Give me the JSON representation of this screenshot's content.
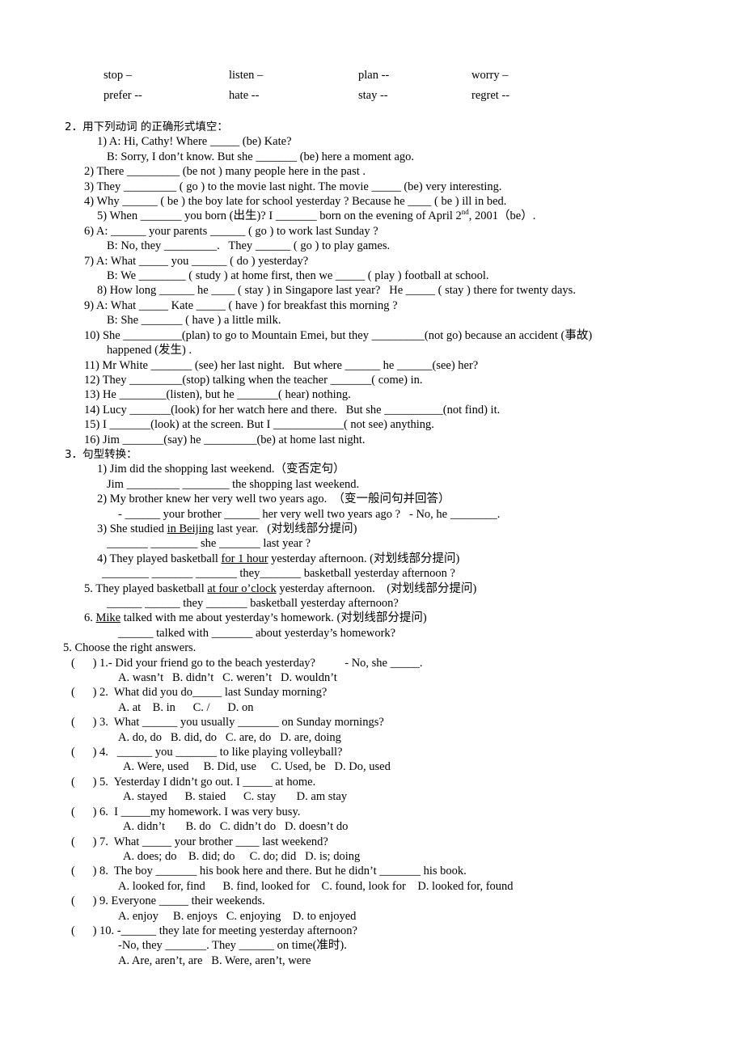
{
  "document": {
    "type": "english-grammar-worksheet",
    "verb_list": {
      "rows": [
        [
          "stop –",
          "listen –",
          "plan --",
          "worry –"
        ],
        [
          "prefer --",
          "hate --",
          "stay --",
          "regret --"
        ]
      ]
    },
    "section2": {
      "heading": "2．用下列动词 的正确形式填空：",
      "items": [
        {
          "id": "2-1a",
          "text": "1) A: Hi, Cathy! Where _____ (be) Kate?"
        },
        {
          "id": "2-1b",
          "text": "B: Sorry, I don’t know. But she _______ (be) here a moment ago."
        },
        {
          "id": "2-2",
          "text": "2) There _________ (be not ) many people here in the past ."
        },
        {
          "id": "2-3",
          "text": "3) They _________ ( go ) to the movie last night. The movie _____ (be) very interesting."
        },
        {
          "id": "2-4",
          "text": "4) Why ______ ( be ) the boy late for school yesterday ? Because he ____ ( be ) ill in bed."
        },
        {
          "id": "2-5pre",
          "text": "5) When _______ you born (出生)? I _______ born on the evening of April 2"
        },
        {
          "id": "2-5sup",
          "text": "nd"
        },
        {
          "id": "2-5post",
          "text": ", 2001（be）."
        },
        {
          "id": "2-6a",
          "text": "6) A: ______ your parents ______ ( go ) to work last Sunday ?"
        },
        {
          "id": "2-6b",
          "text": "B: No, they _________.   They ______ ( go ) to play games."
        },
        {
          "id": "2-7a",
          "text": "7) A: What _____ you ______ ( do ) yesterday?"
        },
        {
          "id": "2-7b",
          "text": "B: We ________ ( study ) at home first, then we _____ ( play ) football at school."
        },
        {
          "id": "2-8",
          "text": "8) How long ______ he ____ ( stay ) in Singapore last year?   He _____ ( stay ) there for twenty days."
        },
        {
          "id": "2-9a",
          "text": "9) A: What _____ Kate _____ ( have ) for breakfast this morning ?"
        },
        {
          "id": "2-9b",
          "text": "B: She _______ ( have ) a little milk."
        },
        {
          "id": "2-10a",
          "text": "10) She __________(plan) to go to Mountain Emei, but they _________(not go) because an accident (事故)"
        },
        {
          "id": "2-10b",
          "text": "happened (发生) ."
        },
        {
          "id": "2-11",
          "text": "11) Mr White _______ (see) her last night.   But where ______ he ______(see) her?"
        },
        {
          "id": "2-12",
          "text": "12) They _________(stop) talking when the teacher _______( come) in."
        },
        {
          "id": "2-13",
          "text": "13) He ________(listen), but he _______( hear) nothing."
        },
        {
          "id": "2-14",
          "text": "14) Lucy _______(look) for her watch here and there.   But she __________(not find) it."
        },
        {
          "id": "2-15",
          "text": "15) I _______(look) at the screen. But I ____________( not see) anything."
        },
        {
          "id": "2-16",
          "text": "16) Jim _______(say) he _________(be) at home last night."
        }
      ]
    },
    "section3": {
      "heading": "3．句型转换：",
      "items": [
        {
          "id": "3-1q",
          "text": "1) Jim did the shopping last weekend.（变否定句）"
        },
        {
          "id": "3-1a",
          "text": "Jim _________ ________ the shopping last weekend."
        },
        {
          "id": "3-2q",
          "text": "2) My brother knew her very well two years ago.  （变一般问句并回答）"
        },
        {
          "id": "3-2a",
          "text": "- ______ your brother ______ her very well two years ago ?   - No, he ________."
        },
        {
          "id": "3-3q",
          "text": "3) She studied in Beijing last year.   (对划线部分提问)"
        },
        {
          "id": "3-3q_underline",
          "text": "in Beijing"
        },
        {
          "id": "3-3a",
          "text": "_______ ________ she _______ last year ?"
        },
        {
          "id": "3-4q",
          "text": "4) They played basketball for 1 hour yesterday afternoon. (对划线部分提问)"
        },
        {
          "id": "3-4q_underline",
          "text": "for 1 hour"
        },
        {
          "id": "3-4a",
          "text": "________ _______ _______ they_______ basketball yesterday afternoon ?"
        },
        {
          "id": "3-5q",
          "text": "5. They played basketball at four o’clock yesterday afternoon.    (对划线部分提问)"
        },
        {
          "id": "3-5q_underline",
          "text": "at four o’clock"
        },
        {
          "id": "3-5a",
          "text": "______ ______ they _______ basketball yesterday afternoon?"
        },
        {
          "id": "3-6q",
          "text": "6. Mike talked with me about yesterday’s homework. (对划线部分提问)"
        },
        {
          "id": "3-6q_underline",
          "text": "Mike"
        },
        {
          "id": "3-6a",
          "text": "______ talked with _______ about yesterday’s homework?"
        }
      ]
    },
    "section5": {
      "heading": "5. Choose the right answers.",
      "questions": [
        {
          "num": "1.",
          "bracket": "(      ) ",
          "stem": "- Did your friend go to the beach yesterday?          - No, she _____.",
          "options": "A. wasn’t   B. didn’t   C. weren’t   D. wouldn’t",
          "options_indent": "i4"
        },
        {
          "num": "2.",
          "bracket": "(      ) ",
          "stem": "  What did you do_____ last Sunday morning?",
          "options": "A. at    B. in      C. /      D. on",
          "options_indent": "i4"
        },
        {
          "num": "3.",
          "bracket": "(      ) ",
          "stem": "  What ______ you usually _______ on Sunday mornings?",
          "options": "A. do, do   B. did, do   C. are, do   D. are, doing",
          "options_indent": "i4"
        },
        {
          "num": "4.",
          "bracket": "(      ) ",
          "stem": "   ______ you _______ to like playing volleyball?",
          "options": "A. Were, used     B. Did, use     C. Used, be   D. Do, used",
          "options_indent": "i5"
        },
        {
          "num": "5.",
          "bracket": "(      ) ",
          "stem": "  Yesterday I didn’t go out. I _____ at home.",
          "options": "A. stayed      B. staied      C. stay       D. am stay",
          "options_indent": "i5"
        },
        {
          "num": "6.",
          "bracket": "(      ) ",
          "stem": "  I _____my homework. I was very busy.",
          "options": "A. didn’t       B. do   C. didn’t do   D. doesn’t do",
          "options_indent": "i5"
        },
        {
          "num": "7.",
          "bracket": "(      ) ",
          "stem": "  What _____ your brother ____ last weekend?",
          "options": "A. does; do    B. did; do     C. do; did   D. is; doing",
          "options_indent": "i5"
        },
        {
          "num": "8.",
          "bracket": "(      ) ",
          "stem": "  The boy _______ his book here and there. But he didn’t _______ his book.",
          "options": "A. looked for, find      B. find, looked for    C. found, look for    D. looked for, found",
          "options_indent": "i4"
        },
        {
          "num": "9.",
          "bracket": "(      ) ",
          "stem": " Everyone _____ their weekends.",
          "options": "A. enjoy     B. enjoys   C. enjoying    D. to enjoyed",
          "options_indent": "i4"
        },
        {
          "num": "10.",
          "bracket": "(      ) ",
          "stem": " -______ they late for meeting yesterday afternoon?",
          "stem2": "-No, they _______. They ______ on time(准时).",
          "options": "A. Are, aren’t, are   B. Were, aren’t, were",
          "options_indent": "i4"
        }
      ]
    }
  }
}
